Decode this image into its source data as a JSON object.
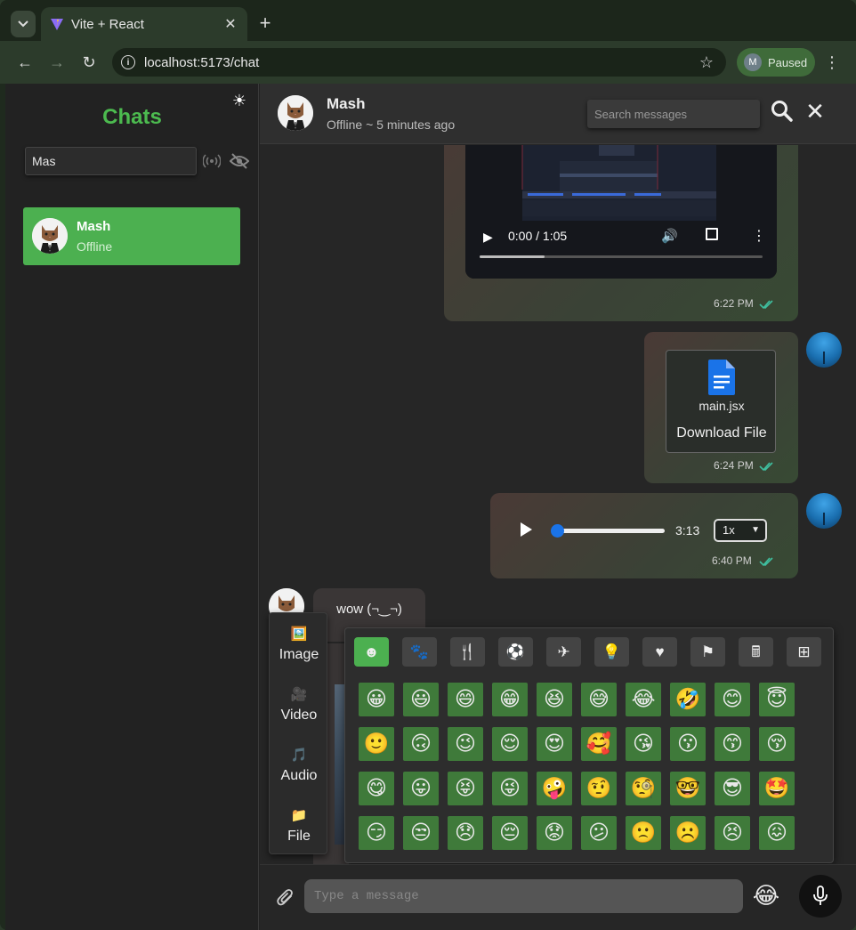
{
  "browser": {
    "tab_title": "Vite + React",
    "url": "localhost:5173/chat",
    "profile_initial": "M",
    "profile_label": "Paused"
  },
  "sidebar": {
    "title": "Chats",
    "search_value": "Mas",
    "contacts": [
      {
        "name": "Mash",
        "status": "Offline"
      }
    ]
  },
  "chat": {
    "contact_name": "Mash",
    "contact_status": "Offline ~ 5 minutes ago",
    "search_placeholder": "Search messages",
    "messages": [
      {
        "type": "video",
        "current_time": "0:00 / 1:05",
        "progress": 0.23,
        "time": "6:22 PM"
      },
      {
        "type": "file",
        "file_name": "main.jsx",
        "link_label": "Download File",
        "time": "6:24 PM"
      },
      {
        "type": "audio",
        "duration": "3:13",
        "speed": "1x",
        "time": "6:40 PM"
      },
      {
        "type": "text",
        "text": "wow (¬‿¬)"
      }
    ]
  },
  "attach_menu": {
    "items": [
      {
        "icon": "🖼️",
        "label": "Image"
      },
      {
        "icon": "🎥",
        "label": "Video"
      },
      {
        "icon": "🎵",
        "label": "Audio"
      },
      {
        "icon": "📁",
        "label": "File"
      }
    ]
  },
  "emoji_picker": {
    "categories": [
      {
        "name": "smileys",
        "glyph": "☻"
      },
      {
        "name": "animals",
        "glyph": "🐾"
      },
      {
        "name": "food",
        "glyph": "🍴"
      },
      {
        "name": "activities",
        "glyph": "⚽"
      },
      {
        "name": "travel",
        "glyph": "✈"
      },
      {
        "name": "objects",
        "glyph": "💡"
      },
      {
        "name": "symbols",
        "glyph": "♥"
      },
      {
        "name": "flags",
        "glyph": "⚑"
      },
      {
        "name": "calculator",
        "glyph": "🖩"
      },
      {
        "name": "grid",
        "glyph": "⊞"
      }
    ],
    "emojis": [
      [
        "😀",
        "😃",
        "😄",
        "😁",
        "😆",
        "😅",
        "😂",
        "🤣",
        "😊",
        "😇"
      ],
      [
        "🙂",
        "🙃",
        "😉",
        "😌",
        "😍",
        "🥰",
        "😘",
        "😗",
        "😙",
        "😚"
      ],
      [
        "😋",
        "😛",
        "😝",
        "😜",
        "🤪",
        "🤨",
        "🧐",
        "🤓",
        "😎",
        "🤩"
      ],
      [
        "😏",
        "😒",
        "😞",
        "😔",
        "😟",
        "😕",
        "🙁",
        "☹️",
        "😣",
        "😖"
      ]
    ]
  },
  "composer": {
    "placeholder": "Type a message",
    "emoji_button": "😂"
  },
  "colors": {
    "accent": "#4cb050",
    "emoji_cell": "#3f7a3a",
    "read_tick": "#3fbf9f"
  }
}
